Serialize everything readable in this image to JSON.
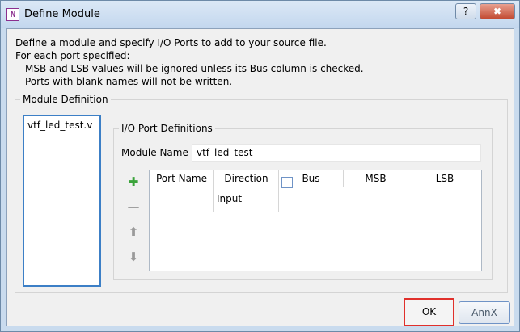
{
  "window": {
    "title": "Define Module",
    "help_label": "?",
    "close_label": "✖"
  },
  "instructions": {
    "line1": "Define a module and specify I/O Ports to add to your source file.",
    "line2": "For each port specified:",
    "line3": "MSB and LSB values will be ignored unless its Bus column is checked.",
    "line4": "Ports with blank names will not be written."
  },
  "module_definition": {
    "label": "Module Definition",
    "files": [
      "vtf_led_test.v"
    ]
  },
  "io_ports": {
    "label": "I/O Port Definitions",
    "module_name_label": "Module Name",
    "module_name_value": "vtf_led_test",
    "buttons": {
      "add": "✚",
      "remove": "—",
      "up": "⬆",
      "down": "⬇"
    },
    "columns": [
      "Port Name",
      "Direction",
      "Bus",
      "MSB",
      "LSB"
    ],
    "rows": [
      {
        "port_name": "",
        "direction": "Input",
        "bus": false,
        "msb": "",
        "lsb": ""
      }
    ]
  },
  "footer": {
    "ok_label": "OK",
    "cancel_label": "AnnX"
  },
  "colors": {
    "add_icon": "#3aa33a",
    "disabled_icon": "#9a9a9a",
    "highlight": "#e0302b"
  }
}
